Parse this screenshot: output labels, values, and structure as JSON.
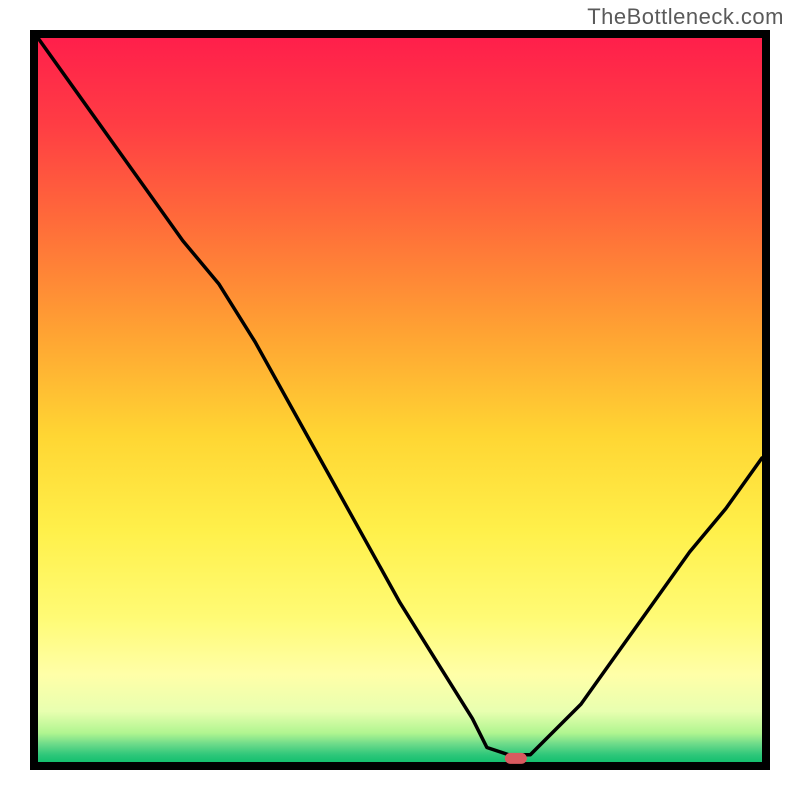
{
  "watermark": "TheBottleneck.com",
  "chart_data": {
    "type": "line",
    "title": "",
    "xlabel": "",
    "ylabel": "",
    "xlim": [
      0,
      100
    ],
    "ylim": [
      0,
      100
    ],
    "x": [
      0,
      5,
      10,
      15,
      20,
      25,
      30,
      35,
      40,
      45,
      50,
      55,
      60,
      62,
      65,
      68,
      70,
      75,
      80,
      85,
      90,
      95,
      100
    ],
    "values": [
      100,
      93,
      86,
      79,
      72,
      66,
      58,
      49,
      40,
      31,
      22,
      14,
      6,
      2,
      1,
      1,
      3,
      8,
      15,
      22,
      29,
      35,
      42
    ],
    "marker_point": {
      "x": 66,
      "y": 0.5
    },
    "gradient_stops": [
      {
        "offset": 0.0,
        "color": "#ff1f4b"
      },
      {
        "offset": 0.12,
        "color": "#ff3d44"
      },
      {
        "offset": 0.25,
        "color": "#ff6a3a"
      },
      {
        "offset": 0.4,
        "color": "#ffa033"
      },
      {
        "offset": 0.55,
        "color": "#ffd633"
      },
      {
        "offset": 0.68,
        "color": "#fff04a"
      },
      {
        "offset": 0.8,
        "color": "#fffb75"
      },
      {
        "offset": 0.88,
        "color": "#ffffa8"
      },
      {
        "offset": 0.93,
        "color": "#e8ffb0"
      },
      {
        "offset": 0.96,
        "color": "#b0f590"
      },
      {
        "offset": 0.975,
        "color": "#6edb8a"
      },
      {
        "offset": 0.99,
        "color": "#2ec77a"
      },
      {
        "offset": 1.0,
        "color": "#14c06e"
      }
    ],
    "marker_color": "#d85a5f",
    "line_color": "#000000",
    "border_color": "#000000"
  }
}
